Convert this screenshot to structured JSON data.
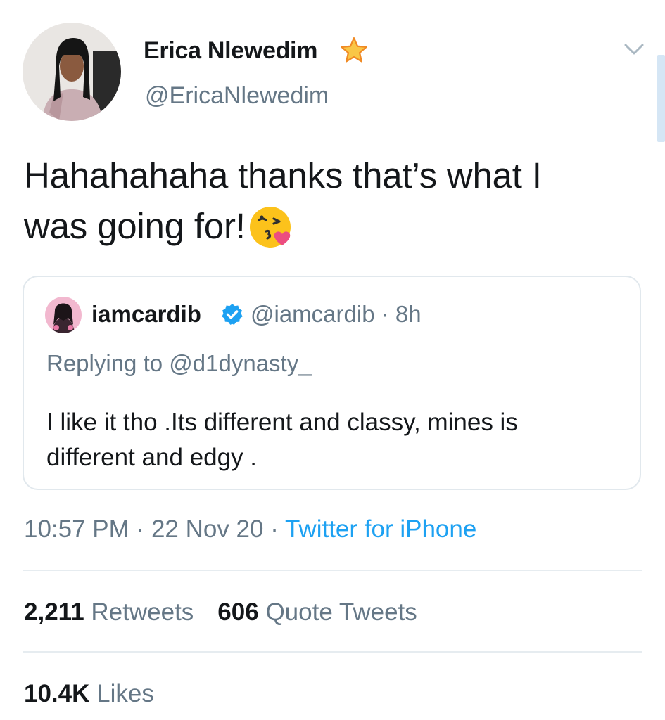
{
  "tweet": {
    "author": {
      "name": "Erica Nlewedim",
      "handle": "@EricaNlewedim",
      "badge_icon": "star-icon"
    },
    "text_line1": "Hahahahaha thanks that’s what I",
    "text_line2": "was going for!",
    "emoji": "face-throwing-a-kiss-emoji",
    "quoted": {
      "name": "iamcardib",
      "verified": true,
      "handle": "@iamcardib",
      "separator": "·",
      "time": "8h",
      "reply_prefix": "Replying to",
      "reply_to": "@d1dynasty_",
      "text_line1": "I like it tho .Its different and classy, mines is",
      "text_line2": "different and edgy ."
    },
    "meta": {
      "time": "10:57 PM",
      "separator1": "·",
      "date": "22 Nov 20",
      "separator2": "·",
      "source": "Twitter for iPhone"
    },
    "stats": {
      "retweets_count": "2,211",
      "retweets_label": "Retweets",
      "quotes_count": "606",
      "quotes_label": "Quote Tweets",
      "likes_count": "10.4K",
      "likes_label": "Likes"
    }
  },
  "colors": {
    "text": "#14171a",
    "secondary": "#657786",
    "link": "#1da1f2",
    "verified": "#1da1f2",
    "border": "#e1e8ed",
    "star": "#f5a623"
  }
}
